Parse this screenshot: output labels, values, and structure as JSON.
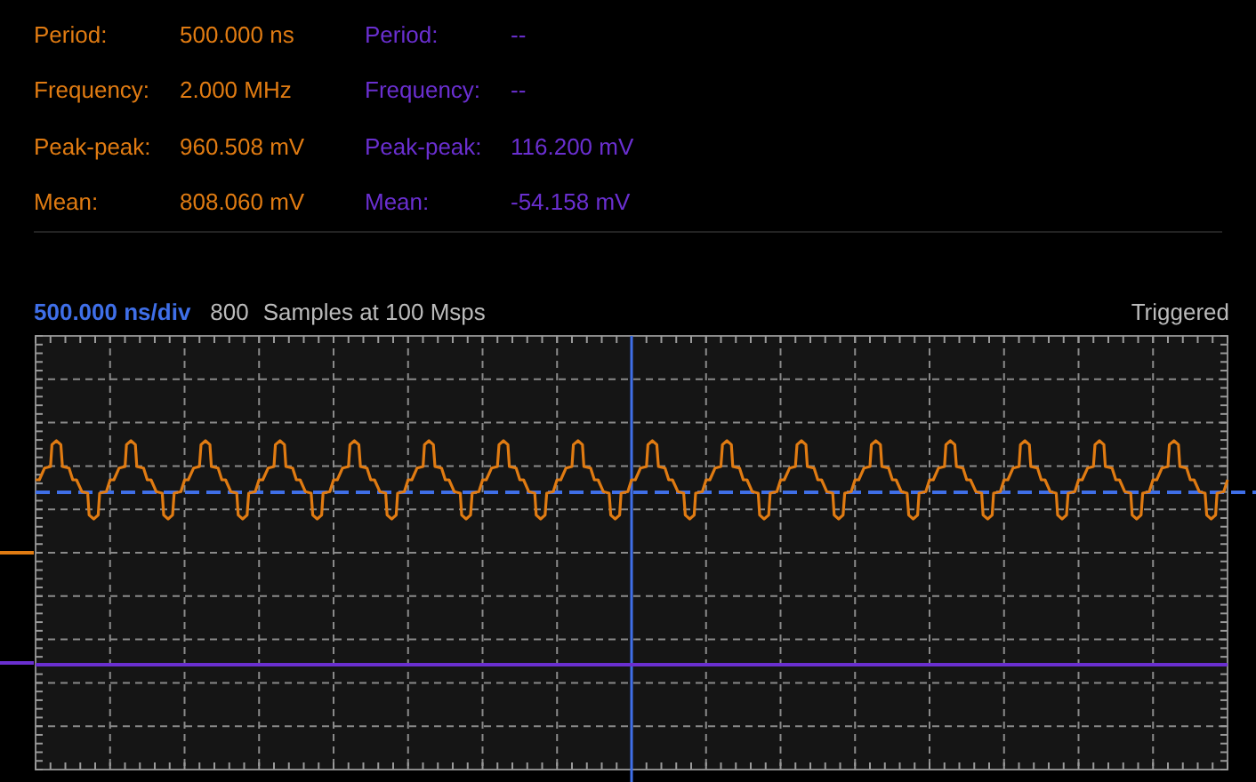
{
  "measurements": [
    {
      "color": "#e07b12",
      "rows": [
        {
          "label": "Period:",
          "value": "500.000 ns"
        },
        {
          "label": "Frequency:",
          "value": "2.000 MHz"
        },
        {
          "label": "Peak-peak:",
          "value": "960.508 mV"
        },
        {
          "label": "Mean:",
          "value": "808.060 mV"
        }
      ]
    },
    {
      "color": "#6a2fd0",
      "rows": [
        {
          "label": "Period:",
          "value": "--"
        },
        {
          "label": "Frequency:",
          "value": "--"
        },
        {
          "label": "Peak-peak:",
          "value": "116.200 mV"
        },
        {
          "label": "Mean:",
          "value": "-54.158 mV"
        }
      ]
    }
  ],
  "header": {
    "timebase": "500.000 ns/div",
    "sample_count": "800",
    "sample_text": "Samples at 100 Msps",
    "status": "Triggered"
  }
}
